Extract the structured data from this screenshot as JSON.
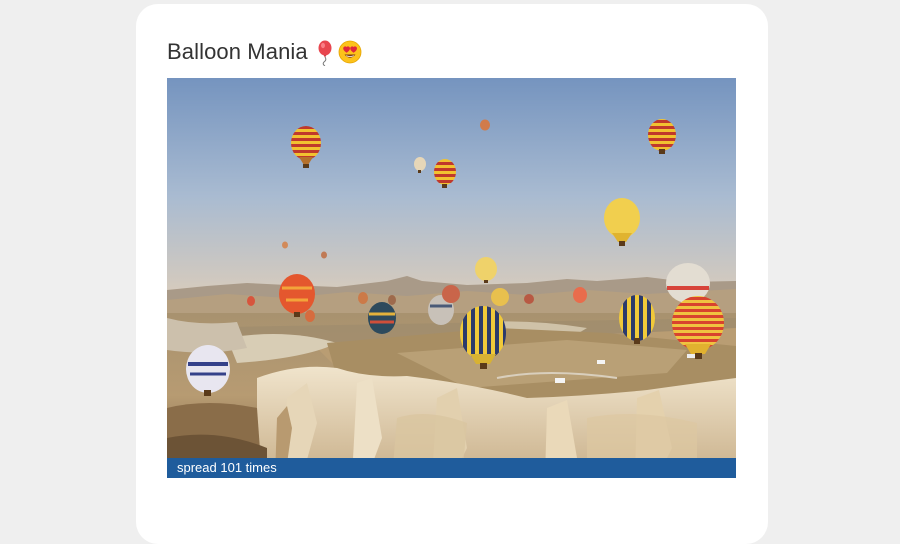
{
  "post": {
    "title": "Balloon Mania",
    "title_emojis": [
      "balloon-emoji",
      "heart-eyes-emoji"
    ]
  },
  "photo": {
    "subject": "hot-air-balloons-over-rock-valley"
  },
  "footer": {
    "spread_text": "spread 101 times"
  },
  "colors": {
    "page_background": "#efefef",
    "card_background": "#ffffff",
    "spread_bar": "#1f5c9c",
    "title_text": "#333333"
  }
}
